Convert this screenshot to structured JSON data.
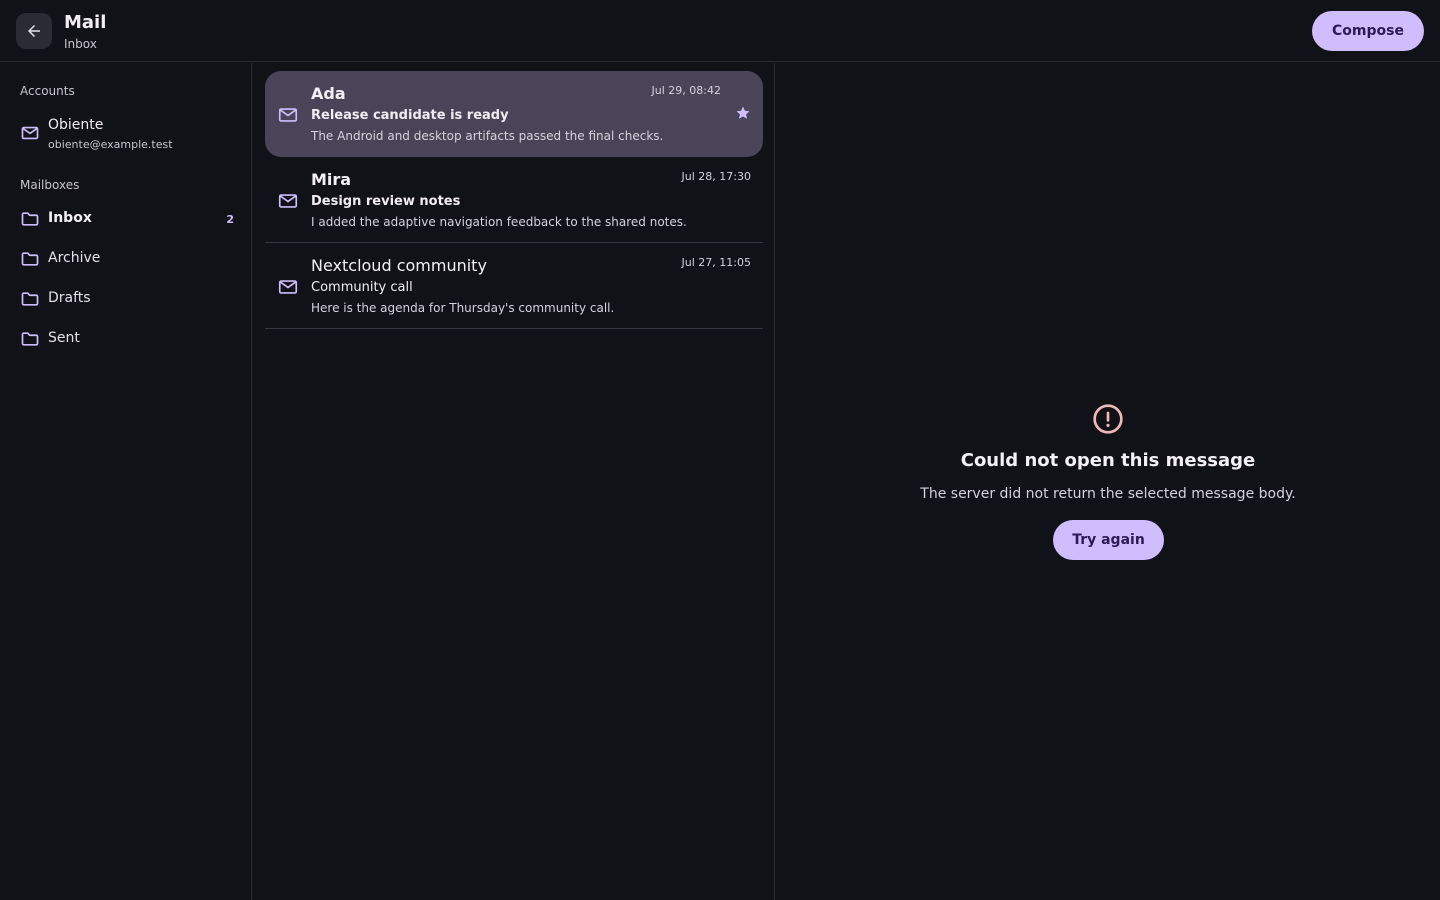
{
  "header": {
    "title": "Mail",
    "subtitle": "Inbox",
    "compose_label": "Compose"
  },
  "sidebar": {
    "accounts_label": "Accounts",
    "account": {
      "name": "Obiente",
      "email": "obiente@example.test",
      "icon": "mail-icon"
    },
    "mailboxes_label": "Mailboxes",
    "mailboxes": [
      {
        "label": "Inbox",
        "count": "2",
        "icon": "folder-icon"
      },
      {
        "label": "Archive",
        "icon": "folder-icon"
      },
      {
        "label": "Drafts",
        "icon": "folder-icon"
      },
      {
        "label": "Sent",
        "icon": "folder-icon"
      }
    ]
  },
  "messages": [
    {
      "sender": "Ada",
      "subject": "Release candidate is ready",
      "preview": "The Android and desktop artifacts passed the final checks.",
      "time": "Jul 29, 08:42",
      "starred": true,
      "selected": true
    },
    {
      "sender": "Mira",
      "subject": "Design review notes",
      "preview": "I added the adaptive navigation feedback to the shared notes.",
      "time": "Jul 28, 17:30",
      "starred": false,
      "selected": false
    },
    {
      "sender": "Nextcloud community",
      "subject": "Community call",
      "preview": "Here is the agenda for Thursday's community call.",
      "time": "Jul 27, 11:05",
      "starred": false,
      "selected": false
    }
  ],
  "detail": {
    "error_title": "Could not open this message",
    "error_body": "The server did not return the selected message body.",
    "retry_label": "Try again"
  },
  "colors": {
    "background": "#111218",
    "accent": "#cfbdfe",
    "selected_row": "#4a4458",
    "error": "#f2b8b5"
  }
}
